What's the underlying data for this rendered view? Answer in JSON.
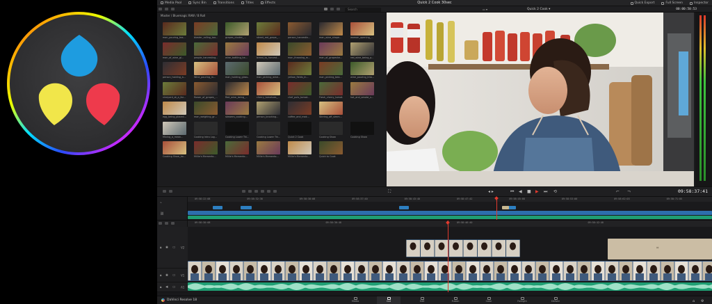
{
  "brand_colors": {
    "accent_red": "#e23a2e",
    "audio_green": "#1f9e73",
    "video_blue": "#2d7fc1",
    "logo_blue": "#1e9ce0",
    "logo_yellow": "#f1e64a",
    "logo_red": "#ee3a4c"
  },
  "topbar": {
    "items": [
      {
        "label": "Media Pool",
        "icon": "media-pool-icon"
      },
      {
        "label": "Sync Bin",
        "icon": "sync-bin-icon"
      },
      {
        "label": "Transitions",
        "icon": "transitions-icon"
      },
      {
        "label": "Titles",
        "icon": "titles-icon"
      },
      {
        "label": "Effects",
        "icon": "effects-icon"
      }
    ],
    "project_title": "Quick 2 Cook 30sec",
    "right_items": [
      {
        "label": "Quick Export",
        "icon": "export-icon"
      },
      {
        "label": "Full Screen",
        "icon": "fullscreen-icon"
      },
      {
        "label": "Inspector",
        "icon": "inspector-icon"
      }
    ]
  },
  "subbar": {
    "search_placeholder": "Search",
    "timeline_name": "Quick 2 Cook",
    "timecode": "00:00:50:53"
  },
  "media_pool": {
    "breadcrumb": "Master / Bluemagic RAW / B Roll",
    "clips": [
      "man_pouring_tea...",
      "blaster_rolling_too...",
      "grapes_cluster_...",
      "street_red_grape_...",
      "person_harvestin...",
      "man_wine_shape...",
      "woman_opening_...",
      "man_of_wine_gl...",
      "people_harvesting...",
      "wine_bottling_ha...",
      "bread_to_harvest...",
      "man_throwing_m...",
      "man_of_grapeshe...",
      "red_wine_being_p...",
      "person_holding_a...",
      "Wine_pouring_in...",
      "man_holding_glass...",
      "man_picking_wine...",
      "yellow_fields_in...",
      "man_picking_bea...",
      "wine_pouring_into...",
      "vineyard_at_a_far...",
      "flower_of_grapes_...",
      "Red_wine_being_...",
      "cherry_tomatoes_...",
      "chef_puts_tomat...",
      "Fresh_cherry_tomat...",
      "hot_and_smoke_s...",
      "egg_being_placed...",
      "man_weighing_gr...",
      "skewers_cooking...",
      "person_brushing...",
      "coffee_and_mak...",
      "Stirring_off_simm...",
      "",
      "Mixing_a_mean...",
      "Cooking Intro Log...",
      "Cooking Lower Thi...",
      "Cooking Lower Thi...",
      "Quick 2 Cook",
      "Cooking Show",
      "Cooking Show",
      "Cooking Show_bo...",
      "Millie's Memento...",
      "Millie's Memento...",
      "Millie's Memento...",
      "Millie's Memento...",
      "Quick to Cook"
    ]
  },
  "transport": {
    "timecode": "09:58:37:41",
    "buttons": [
      "skip-back",
      "step-back",
      "stop",
      "play",
      "step-forward",
      "loop"
    ]
  },
  "upper_timeline": {
    "ticks": [
      "09:58:22:08",
      "09:58:32:38",
      "09:58:38:08",
      "09:58:37:40",
      "09:58:43:40",
      "09:58:47:42",
      "09:58:45:68",
      "09:58:53:00",
      "09:58:62:03",
      "09:58:71:05"
    ]
  },
  "lower_timeline": {
    "ticks": [
      "09:58:30:08",
      "09:58:36:40",
      "09:58:46:40",
      "09:58:42:40"
    ],
    "tracks": [
      {
        "name": "V2",
        "type": "video"
      },
      {
        "name": "V1",
        "type": "video"
      },
      {
        "name": "A1",
        "type": "audio"
      }
    ]
  },
  "pagebar": {
    "brand": "DaVinci Resolve 18",
    "pages": [
      {
        "label": "Media",
        "icon": "media-page-icon",
        "active": false
      },
      {
        "label": "Cut",
        "icon": "cut-page-icon",
        "active": true
      },
      {
        "label": "Edit",
        "icon": "edit-page-icon",
        "active": false
      },
      {
        "label": "Fusion",
        "icon": "fusion-page-icon",
        "active": false
      },
      {
        "label": "Color",
        "icon": "color-page-icon",
        "active": false
      },
      {
        "label": "Fairlight",
        "icon": "fairlight-page-icon",
        "active": false
      },
      {
        "label": "Deliver",
        "icon": "deliver-page-icon",
        "active": false
      }
    ]
  }
}
